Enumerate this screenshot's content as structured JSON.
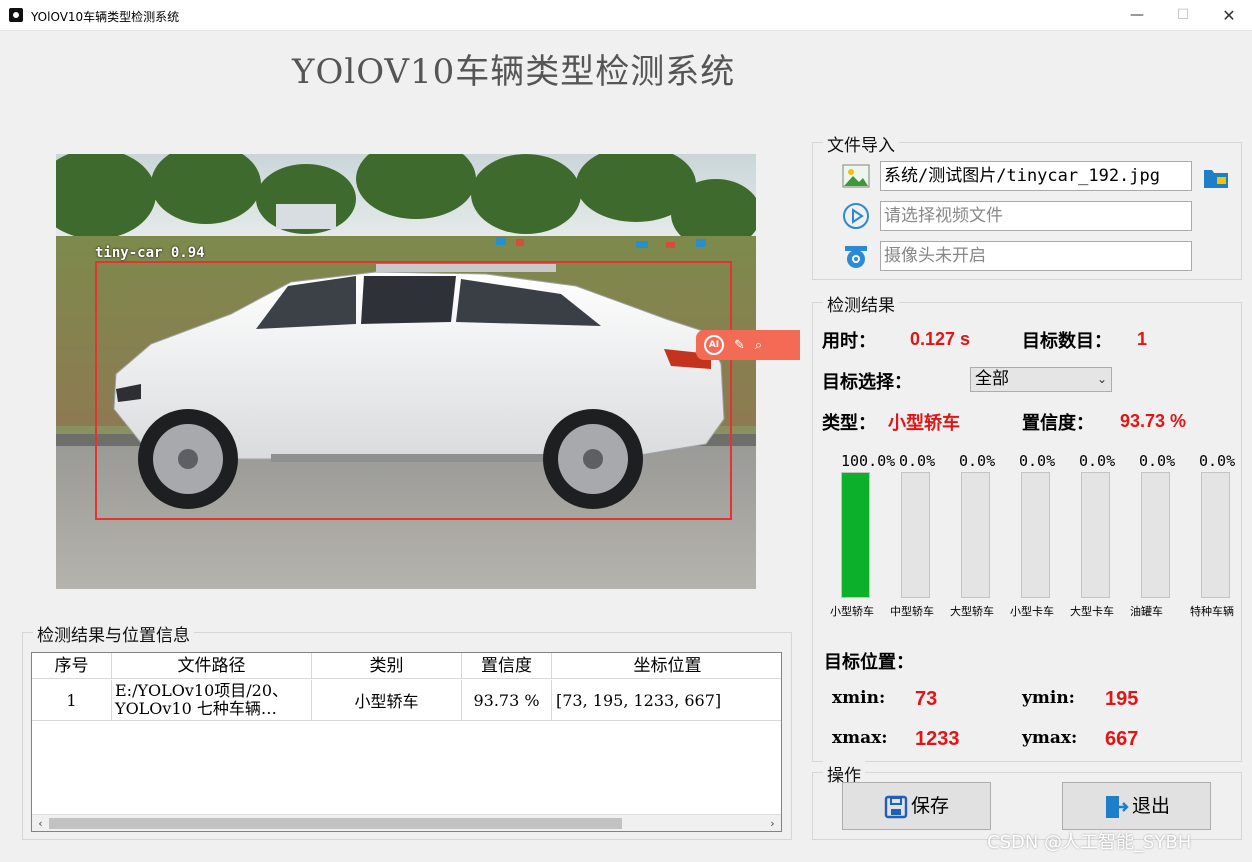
{
  "window": {
    "title": "YOlOV10车辆类型检测系统"
  },
  "header": {
    "title": "YOlOV10车辆类型检测系统"
  },
  "detection_image": {
    "box_label": "tiny-car 0.94",
    "ai_badge": "AI"
  },
  "file_import": {
    "title": "文件导入",
    "image_path": "系统/测试图片/tinycar_192.jpg",
    "video_placeholder": "请选择视频文件",
    "camera_status": "摄像头未开启"
  },
  "results": {
    "title": "检测结果",
    "time_label": "用时：",
    "time_value": "0.127 s",
    "count_label": "目标数目：",
    "count_value": "1",
    "target_select_label": "目标选择：",
    "target_select_value": "全部",
    "type_label": "类型：",
    "type_value": "小型轿车",
    "conf_label": "置信度：",
    "conf_value": "93.73 %",
    "bars": [
      {
        "category": "小型轿车",
        "percent": "100.0%",
        "fill": 1.0
      },
      {
        "category": "中型轿车",
        "percent": "0.0%",
        "fill": 0.0
      },
      {
        "category": "大型轿车",
        "percent": "0.0%",
        "fill": 0.0
      },
      {
        "category": "小型卡车",
        "percent": "0.0%",
        "fill": 0.0
      },
      {
        "category": "大型卡车",
        "percent": "0.0%",
        "fill": 0.0
      },
      {
        "category": "油罐车",
        "percent": "0.0%",
        "fill": 0.0
      },
      {
        "category": "特种车辆",
        "percent": "0.0%",
        "fill": 0.0
      }
    ],
    "position_label": "目标位置：",
    "xmin_label": "xmin:",
    "xmin_value": "73",
    "ymin_label": "ymin:",
    "ymin_value": "195",
    "xmax_label": "xmax:",
    "xmax_value": "1233",
    "ymax_label": "ymax:",
    "ymax_value": "667"
  },
  "operations": {
    "title": "操作",
    "save_label": "保存",
    "exit_label": "退出"
  },
  "table": {
    "title": "检测结果与位置信息",
    "headers": [
      "序号",
      "文件路径",
      "类别",
      "置信度",
      "坐标位置"
    ],
    "rows": [
      {
        "index": "1",
        "path_line1": "E:/YOLOv10项目/20、",
        "path_line2": "YOLOv10 七种车辆…",
        "category": "小型轿车",
        "confidence": "93.73 %",
        "coords": "[73, 195, 1233, 667]"
      }
    ]
  },
  "watermark": "CSDN @人工智能_SYBH",
  "colors": {
    "accent_red": "#e31414",
    "bar_green": "#0db02b",
    "box_red": "#e8322f"
  }
}
